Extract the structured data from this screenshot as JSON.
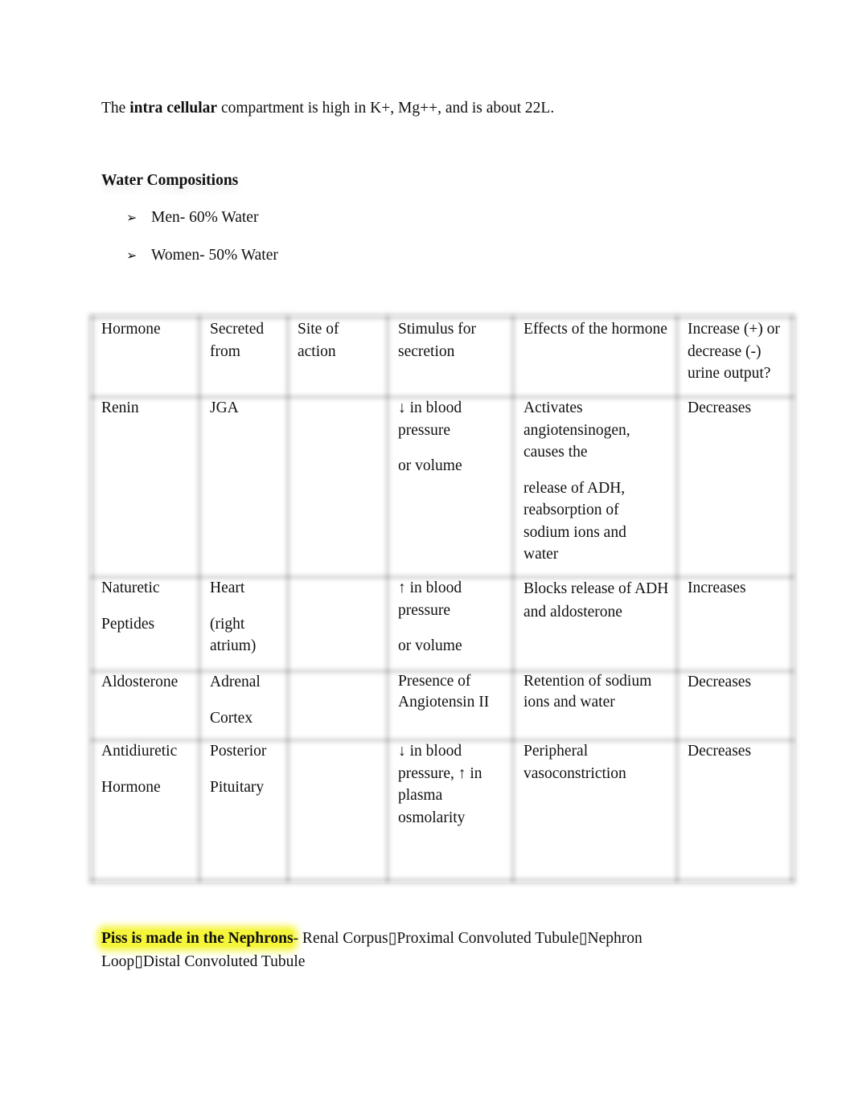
{
  "intro": {
    "prefix": "The",
    "bold": "intra cellular",
    "suffix": "compartment is high in K+, Mg++, and is about 22L."
  },
  "water_compositions": {
    "heading": "Water Compositions",
    "bullet_icon": "arrowhead-bullet-icon",
    "bullet_glyph": "➢",
    "items": [
      "Men- 60% Water",
      "Women- 50% Water"
    ]
  },
  "hormone_table": {
    "headers": [
      "Hormone",
      "Secreted from",
      "Site of action",
      "Stimulus for secretion",
      "Effects of the hormone",
      "Increase (+) or decrease (-) urine output?"
    ],
    "rows": [
      {
        "hormone": [
          "Renin"
        ],
        "secreted_from": [
          "JGA"
        ],
        "site_of_action": [],
        "stimulus": [
          "↓ in blood pressure",
          "or volume"
        ],
        "effects": [
          "Activates angiotensinogen, causes the",
          "release of ADH, reabsorption of sodium ions and water"
        ],
        "urine_output": "Decreases"
      },
      {
        "hormone": [
          "Naturetic",
          "Peptides"
        ],
        "secreted_from": [
          "Heart",
          "(right atrium)"
        ],
        "site_of_action": [],
        "stimulus": [
          "↑ in blood pressure",
          "or volume"
        ],
        "effects": [
          "Blocks release of ADH and aldosterone"
        ],
        "urine_output": "Increases"
      },
      {
        "hormone": [
          "Aldosterone"
        ],
        "secreted_from": [
          "Adrenal",
          "Cortex"
        ],
        "site_of_action": [],
        "stimulus": [
          "Presence of Angiotensin II"
        ],
        "effects": [
          "Retention of sodium ions and water"
        ],
        "urine_output": "Decreases"
      },
      {
        "hormone": [
          "Antidiuretic",
          "Hormone"
        ],
        "secreted_from": [
          "Posterior",
          "Pituitary"
        ],
        "site_of_action": [],
        "stimulus": [
          "↓ in blood pressure, ↑ in plasma osmolarity"
        ],
        "effects": [
          "Peripheral vasoconstriction"
        ],
        "urine_output": "Decreases"
      }
    ]
  },
  "nephron": {
    "highlight": "Piss is made in the Nephrons",
    "highlight_color": "#f5f53a",
    "text": "- Renal Corpus▯Proximal Convoluted Tubule▯Nephron Loop▯Distal Convoluted Tubule"
  }
}
